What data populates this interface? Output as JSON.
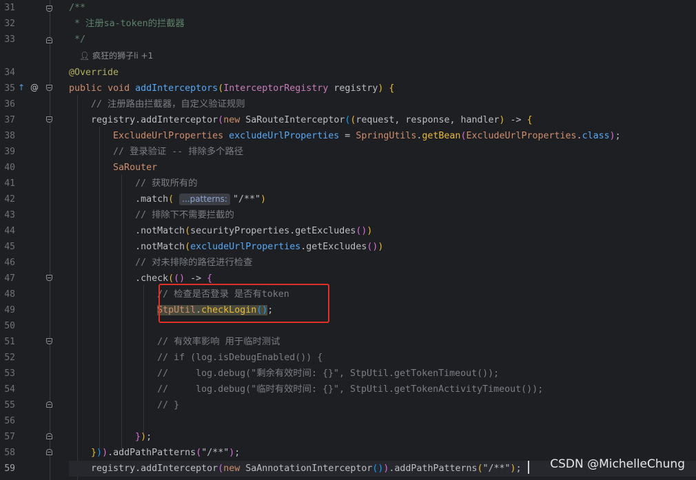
{
  "editor": {
    "line_numbers": [
      "31",
      "32",
      "33",
      "34",
      "35",
      "36",
      "37",
      "38",
      "39",
      "40",
      "41",
      "42",
      "43",
      "44",
      "45",
      "46",
      "47",
      "48",
      "49",
      "50",
      "51",
      "52",
      "53",
      "54",
      "55",
      "56",
      "57",
      "58",
      "59"
    ],
    "author_hint": "疯狂的狮子li +1",
    "gutter_icons": {
      "implementing": "↑",
      "annotation": "@"
    },
    "inlay_hint": "...patterns:",
    "line_31": "/**",
    "line_32": " * 注册sa-token的拦截器",
    "line_33": " */",
    "line_34": "@Override",
    "line_35": {
      "public": "public",
      "void": "void",
      "method": "addInterceptors",
      "param_type": "InterceptorRegistry",
      "param": "registry"
    },
    "line_36": "// 注册路由拦截器，自定义验证规则",
    "line_37": {
      "obj": "registry",
      "method": "addInterceptor",
      "new": "new",
      "cls": "SaRouteInterceptor",
      "params": "request, response, handler"
    },
    "line_38": {
      "type": "ExcludeUrlProperties",
      "var": "excludeUrlProperties",
      "util": "SpringUtils",
      "method": "getBean",
      "arg": "ExcludeUrlProperties",
      "cls": "class"
    },
    "line_39": "// 登录验证 -- 排除多个路径",
    "line_40": "SaRouter",
    "line_41": "// 获取所有的",
    "line_42": {
      "method": "match",
      "arg": "\"/**\""
    },
    "line_43": "// 排除下不需要拦截的",
    "line_44": {
      "method": "notMatch",
      "obj": "securityProperties",
      "getter": "getExcludes"
    },
    "line_45": {
      "method": "notMatch",
      "obj": "excludeUrlProperties",
      "getter": "getExcludes"
    },
    "line_46": "// 对未排除的路径进行检查",
    "line_47": {
      "method": "check"
    },
    "line_48": "// 检查是否登录 是否有token",
    "line_49": {
      "util": "StpUtil",
      "method": "checkLogin"
    },
    "line_51": "// 有效率影响 用于临时测试",
    "line_52": "// if (log.isDebugEnabled()) {",
    "line_53": "//     log.debug(\"剩余有效时间: {}\", StpUtil.getTokenTimeout());",
    "line_54": "//     log.debug(\"临时有效时间: {}\", StpUtil.getTokenActivityTimeout());",
    "line_55": "// }",
    "line_58": {
      "method": "addPathPatterns",
      "arg": "\"/**\""
    },
    "line_59": {
      "obj": "registry",
      "method": "addInterceptor",
      "new": "new",
      "cls": "SaAnnotationInterceptor",
      "method2": "addPathPatterns",
      "arg": "\"/**\""
    }
  },
  "watermark": "CSDN @MichelleChung",
  "colors": {
    "background": "#1e1f22",
    "keyword": "#cf8e6d",
    "comment": "#7a7e85",
    "string": "#6aab73",
    "method": "#56a8f5",
    "class": "#c77dbb",
    "highlight_box": "#e0302a"
  }
}
